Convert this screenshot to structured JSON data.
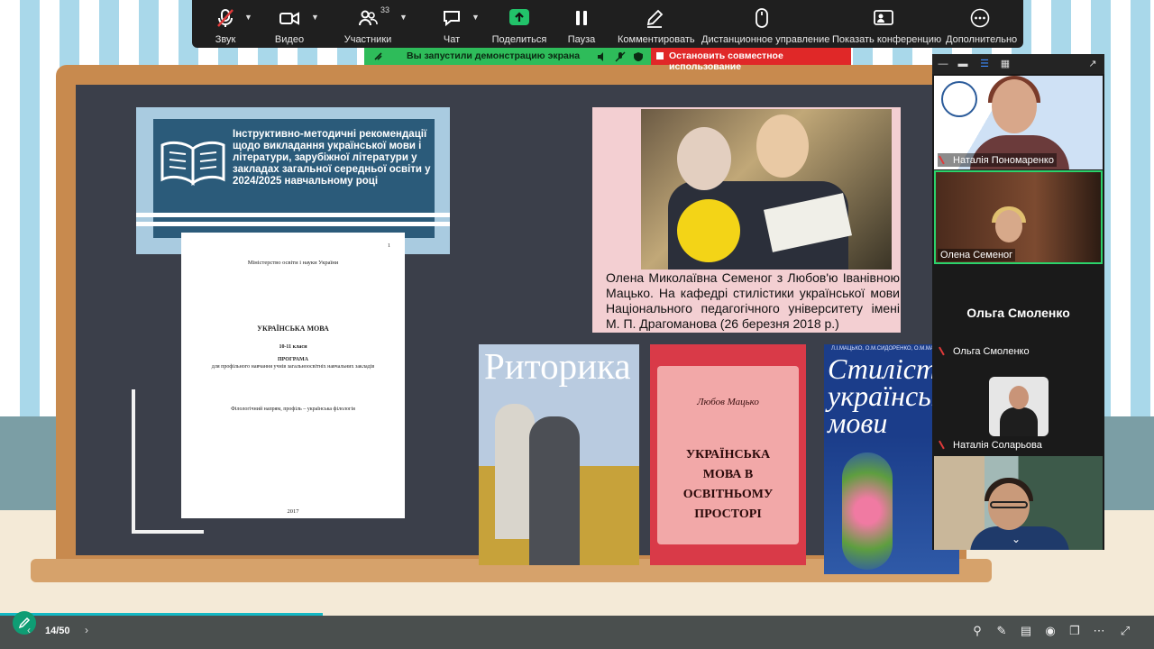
{
  "toolbar": {
    "items": [
      {
        "label": "Звук",
        "icon": "mic-muted-icon"
      },
      {
        "label": "Видео",
        "icon": "video-camera-icon"
      },
      {
        "label": "Участники",
        "icon": "participants-icon",
        "count": "33"
      },
      {
        "label": "Чат",
        "icon": "chat-icon"
      },
      {
        "label": "Поделиться",
        "icon": "share-screen-icon"
      },
      {
        "label": "Пауза",
        "icon": "pause-icon"
      },
      {
        "label": "Комментировать",
        "icon": "annotate-pen-icon"
      },
      {
        "label": "Дистанционное управление",
        "icon": "mouse-icon"
      },
      {
        "label": "Показать конференцию",
        "icon": "show-meeting-icon"
      },
      {
        "label": "Дополнительно",
        "icon": "more-icon"
      }
    ]
  },
  "share_status": {
    "message": "Вы запустили демонстрацию экрана",
    "stop_label": "Остановить совместное использование"
  },
  "slide": {
    "banner_title": "Інструктивно-методичні рекомендації щодо викладання української мови і літератури, зарубіжної літератури у закладах загальної середньої освіти у 2024/2025 навчальному році",
    "document": {
      "page_number": "1",
      "ministry": "Міністерство освіти і науки України",
      "subject": "УКРАЇНСЬКА МОВА",
      "grade": "10-11 класи",
      "program": "ПРОГРАМА",
      "program_desc": "для профільного навчання учнів загальноосвітніх навчальних закладів",
      "direction": "Філологічний напрям, профіль – українська філологія",
      "year": "2017"
    },
    "photo_caption": "Олена Миколаївна Семеног з Любов'ю Іванівною Мацько. На кафедрі стилістики української мови Національного педагогічного університету імені М. П. Драгоманова (26 березня 2018 р.)",
    "books": [
      {
        "title": "Риторика"
      },
      {
        "author": "Любов Мацько",
        "title": "УКРАЇНСЬКА МОВА В ОСВІТНЬОМУ ПРОСТОРІ"
      },
      {
        "authors": "Л.І.МАЦЬКО, О.М.СИДОРЕНКО, О.М.МАЦЬКО",
        "title": "Стилістика української мови"
      }
    ]
  },
  "participants_panel": {
    "tiles": [
      {
        "name": "Наталія Пономаренко",
        "muted": true
      },
      {
        "name": "Олена Семеног",
        "muted": false,
        "active_speaker": true
      },
      {
        "name": "Ольга Смоленко",
        "display_name": "Ольга Смоленко",
        "muted": true
      },
      {
        "name": "Наталія Соларьова",
        "muted": true
      },
      {
        "name": "",
        "muted": false
      }
    ]
  },
  "bottom_bar": {
    "page_indicator": "14/50",
    "progress_fraction": 0.28
  },
  "colors": {
    "toolbar_bg": "#1f1f1f",
    "share_green": "#2ebc5a",
    "stop_red": "#e02828",
    "active_speaker_outline": "#2bd26b",
    "progress": "#14b8c4"
  }
}
